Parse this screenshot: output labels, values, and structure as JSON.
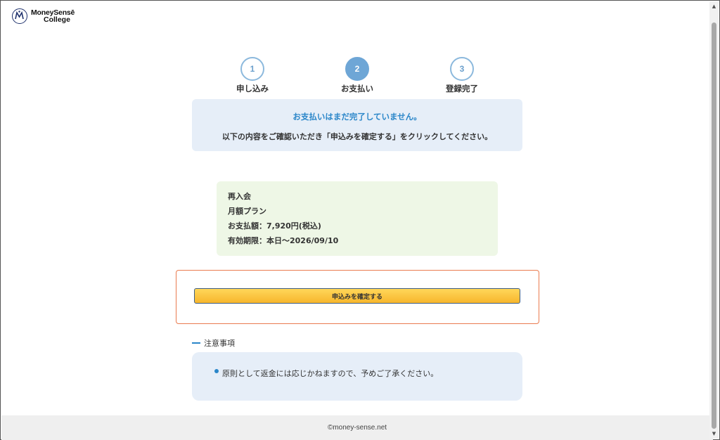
{
  "header": {
    "logo_line1": "MoneySensē",
    "logo_line2": "College",
    "logo_icon": "m-emblem-icon"
  },
  "steps": [
    {
      "number": "1",
      "label": "申し込み",
      "active": false
    },
    {
      "number": "2",
      "label": "お支払い",
      "active": true
    },
    {
      "number": "3",
      "label": "登録完了",
      "active": false
    }
  ],
  "notice": {
    "title": "お支払いはまだ完了していません。",
    "description": "以下の内容をご確認いただき「申込みを確定する」をクリックしてください。"
  },
  "plan": {
    "type": "再入会",
    "name": "月額プラン",
    "amount": "お支払額：7,920円(税込)",
    "expiry": "有効期限：本日～2026/09/10"
  },
  "confirm": {
    "button_label": "申込みを確定する"
  },
  "caution": {
    "title": "注意事項",
    "items": [
      "原則として返金には応じかねますので、予めご了承ください。"
    ]
  },
  "footer": {
    "copyright": "©money-sense.net"
  },
  "colors": {
    "accent_blue": "#2a86c9",
    "step_active": "#6ea6d6",
    "button_yellow": "#f7b62c",
    "confirm_border": "#ea7b4f"
  }
}
